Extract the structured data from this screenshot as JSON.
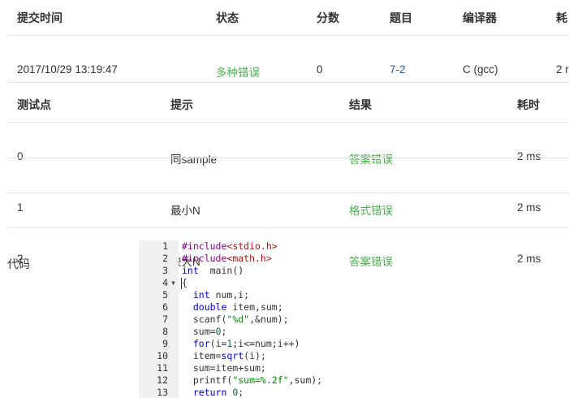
{
  "submission": {
    "headers": [
      "提交时间",
      "状态",
      "分数",
      "题目",
      "编译器",
      "耗"
    ],
    "values": [
      "2017/10/29 13:19:47",
      "多种错误",
      "0",
      "7-2",
      "C (gcc)",
      "2 r"
    ]
  },
  "tests": {
    "headers": [
      "测试点",
      "提示",
      "结果",
      "耗时"
    ],
    "rows": [
      [
        "0",
        "同sample",
        "答案错误",
        "2 ms"
      ],
      [
        "1",
        "最小N",
        "格式错误",
        "2 ms"
      ],
      [
        "2",
        "较大N",
        "答案错误",
        "2 ms"
      ]
    ]
  },
  "code": {
    "label": "代码",
    "lines": [
      {
        "n": "1",
        "t": [
          [
            "mc",
            "#include"
          ],
          [
            "str",
            "<stdio.h>"
          ]
        ]
      },
      {
        "n": "2",
        "t": [
          [
            "mc",
            "#include"
          ],
          [
            "str",
            "<math.h>"
          ]
        ]
      },
      {
        "n": "3",
        "t": [
          [
            "kw",
            "int"
          ],
          [
            "",
            "  main()"
          ]
        ]
      },
      {
        "n": "4",
        "fold": true,
        "t": [
          [
            "",
            "{"
          ]
        ]
      },
      {
        "n": "5",
        "t": [
          [
            "",
            "  "
          ],
          [
            "kw",
            "int"
          ],
          [
            "",
            " num,i;"
          ]
        ]
      },
      {
        "n": "6",
        "t": [
          [
            "",
            "  "
          ],
          [
            "kw",
            "double"
          ],
          [
            "",
            " item,sum;"
          ]
        ]
      },
      {
        "n": "7",
        "t": [
          [
            "",
            "  scanf("
          ],
          [
            "gstr",
            "\"%d\""
          ],
          [
            "",
            ",&num);"
          ]
        ]
      },
      {
        "n": "8",
        "t": [
          [
            "",
            "  sum="
          ],
          [
            "num",
            "0"
          ],
          [
            "",
            ";"
          ]
        ]
      },
      {
        "n": "9",
        "t": [
          [
            "",
            "  "
          ],
          [
            "kw",
            "for"
          ],
          [
            "",
            "(i="
          ],
          [
            "num",
            "1"
          ],
          [
            "",
            ";i<=num;i++)"
          ]
        ]
      },
      {
        "n": "10",
        "t": [
          [
            "",
            "  item="
          ],
          [
            "kw",
            "sqrt"
          ],
          [
            "",
            "(i);"
          ]
        ]
      },
      {
        "n": "11",
        "t": [
          [
            "",
            "  sum=item+sum;"
          ]
        ]
      },
      {
        "n": "12",
        "t": [
          [
            "",
            "  printf("
          ],
          [
            "gstr",
            "\"sum=%.2f\""
          ],
          [
            "",
            ",sum);"
          ]
        ]
      },
      {
        "n": "13",
        "t": [
          [
            "",
            "  "
          ],
          [
            "kw",
            "return"
          ],
          [
            "",
            " "
          ],
          [
            "num",
            "0"
          ],
          [
            "",
            ";"
          ]
        ]
      }
    ]
  }
}
